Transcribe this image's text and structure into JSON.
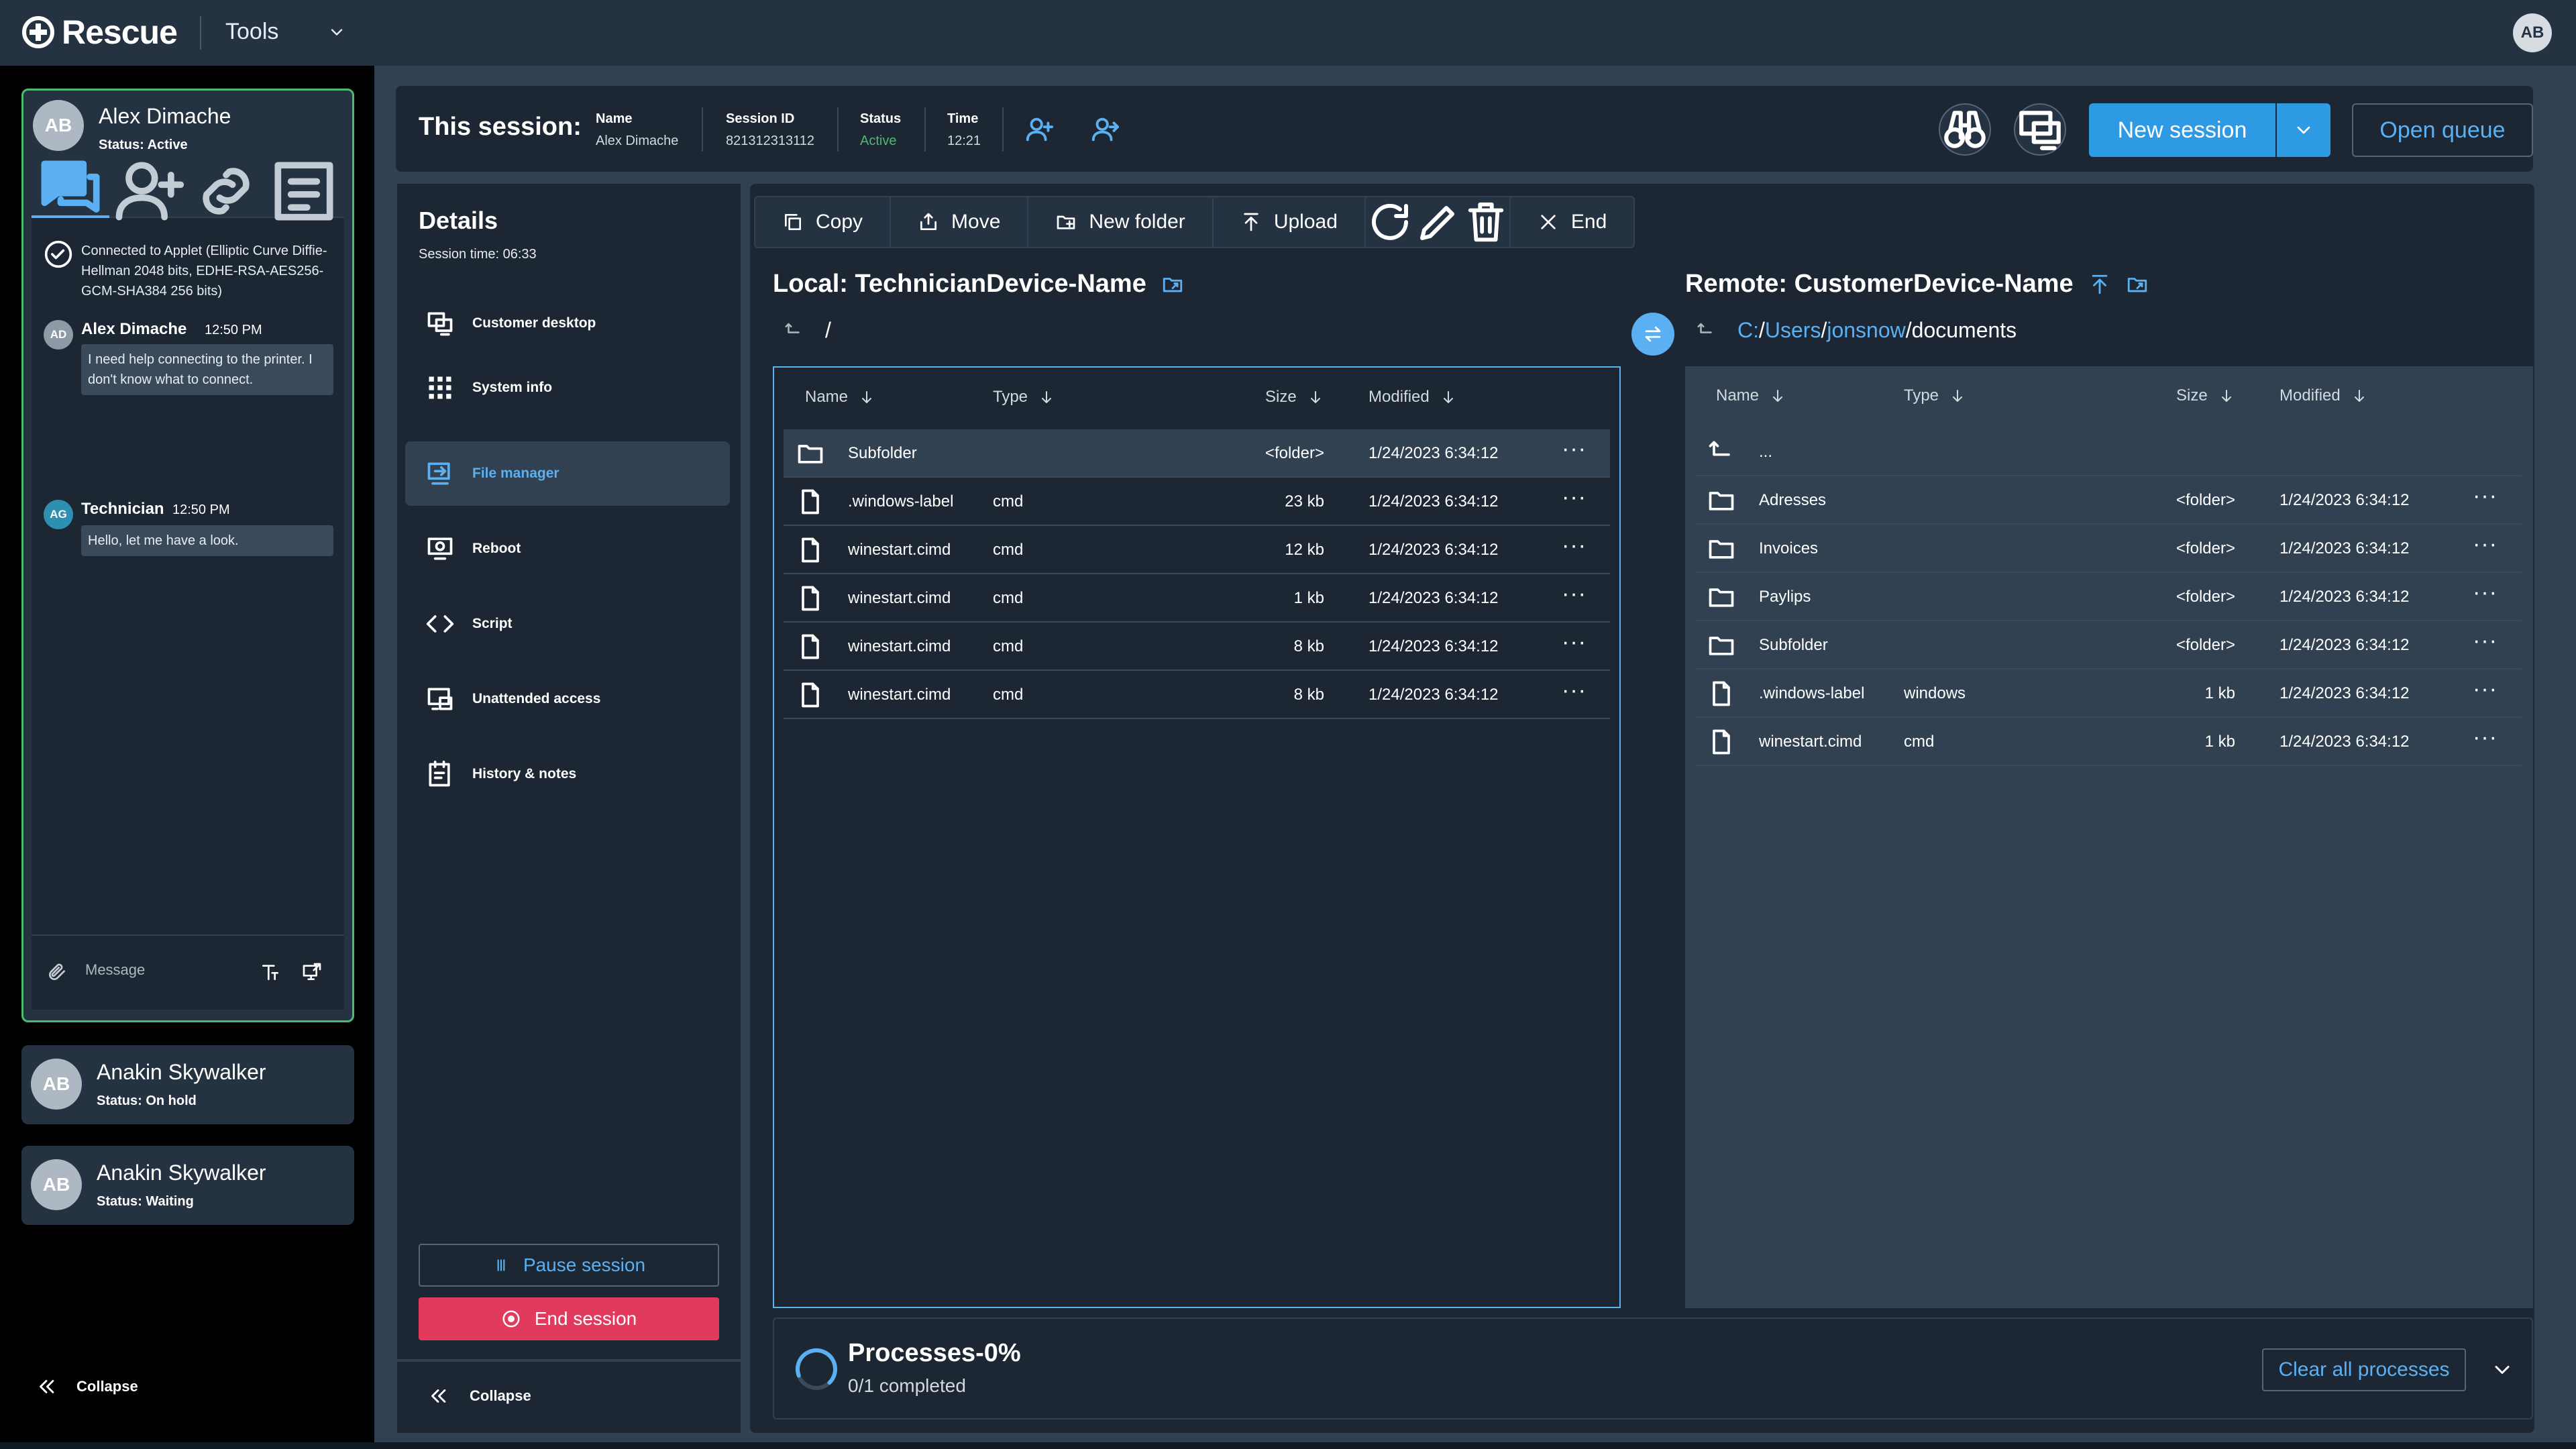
{
  "topbar": {
    "brand": "Rescue",
    "menu_label": "Tools",
    "user_initials": "AB"
  },
  "sessions": [
    {
      "initials": "AB",
      "name": "Alex Dimache",
      "status": "Status: Active"
    },
    {
      "initials": "AB",
      "name": "Anakin Skywalker",
      "status": "Status: On hold"
    },
    {
      "initials": "AB",
      "name": "Anakin Skywalker",
      "status": "Status: Waiting"
    }
  ],
  "chat": {
    "tabs": [
      "chat-icon",
      "add-user-icon",
      "link-icon",
      "notes-icon"
    ],
    "system_message": "Connected to Applet (Elliptic Curve Diffie-Hellman 2048 bits, EDHE-RSA-AES256-GCM-SHA384 256 bits)",
    "messages": [
      {
        "initials": "AD",
        "sender": "Alex Dimache",
        "time": "12:50 PM",
        "text": "I need help connecting to the printer. I don't know what to connect."
      },
      {
        "initials": "AG",
        "sender": "Technician",
        "time": "12:50 PM",
        "text": "Hello, let me have a look."
      }
    ],
    "input_placeholder": "Message"
  },
  "sidebar_collapse": "Collapse",
  "session_bar": {
    "title": "This session:",
    "fields": [
      {
        "label": "Name",
        "value": "Alex Dimache"
      },
      {
        "label": "Session ID",
        "value": "821312313112"
      },
      {
        "label": "Status",
        "value": "Active"
      },
      {
        "label": "Time",
        "value": "12:21"
      }
    ],
    "new_session": "New session",
    "open_queue": "Open queue"
  },
  "details": {
    "title": "Details",
    "session_time": "Session time: 06:33",
    "menu": [
      "Customer desktop",
      "System info",
      "File manager",
      "Reboot",
      "Script",
      "Unattended access",
      "History & notes"
    ],
    "pause": "Pause session",
    "end": "End session",
    "collapse": "Collapse"
  },
  "toolbar": {
    "copy": "Copy",
    "move": "Move",
    "new_folder": "New folder",
    "upload": "Upload",
    "end": "End"
  },
  "local": {
    "title": "Local: TechnicianDevice-Name",
    "path": "/",
    "headers": [
      "Name",
      "Type",
      "Size",
      "Modified"
    ],
    "rows": [
      {
        "icon": "folder-icon",
        "name": "Subfolder",
        "type": "",
        "size": "<folder>",
        "modified": "1/24/2023 6:34:12"
      },
      {
        "icon": "file-icon",
        "name": ".windows-label",
        "type": "cmd",
        "size": "23 kb",
        "modified": "1/24/2023 6:34:12"
      },
      {
        "icon": "file-icon",
        "name": "winestart.cimd",
        "type": "cmd",
        "size": "12 kb",
        "modified": "1/24/2023 6:34:12"
      },
      {
        "icon": "file-icon",
        "name": "winestart.cimd",
        "type": "cmd",
        "size": "1 kb",
        "modified": "1/24/2023 6:34:12"
      },
      {
        "icon": "file-icon",
        "name": "winestart.cimd",
        "type": "cmd",
        "size": "8 kb",
        "modified": "1/24/2023 6:34:12"
      },
      {
        "icon": "file-icon",
        "name": "winestart.cimd",
        "type": "cmd",
        "size": "8 kb",
        "modified": "1/24/2023 6:34:12"
      }
    ]
  },
  "remote": {
    "title": "Remote: CustomerDevice-Name",
    "path": {
      "drive": "C:",
      "sep1": "/",
      "users": "Users",
      "sep2": "/",
      "user": "jonsnow",
      "rest": "/documents"
    },
    "headers": [
      "Name",
      "Type",
      "Size",
      "Modified"
    ],
    "up_label": "...",
    "rows": [
      {
        "icon": "folder-icon",
        "name": "Adresses",
        "type": "",
        "size": "<folder>",
        "modified": "1/24/2023 6:34:12"
      },
      {
        "icon": "folder-icon",
        "name": "Invoices",
        "type": "",
        "size": "<folder>",
        "modified": "1/24/2023 6:34:12"
      },
      {
        "icon": "folder-icon",
        "name": "Paylips",
        "type": "",
        "size": "<folder>",
        "modified": "1/24/2023 6:34:12"
      },
      {
        "icon": "folder-icon",
        "name": "Subfolder",
        "type": "",
        "size": "<folder>",
        "modified": "1/24/2023 6:34:12"
      },
      {
        "icon": "file-icon",
        "name": ".windows-label",
        "type": "windows",
        "size": "1 kb",
        "modified": "1/24/2023 6:34:12"
      },
      {
        "icon": "file-icon",
        "name": "winestart.cimd",
        "type": "cmd",
        "size": "1 kb",
        "modified": "1/24/2023 6:34:12"
      }
    ]
  },
  "processes": {
    "title": "Processes-0%",
    "subtitle": "0/1 completed",
    "progress": 0,
    "clear": "Clear all processes"
  },
  "colors": {
    "accent": "#5ab0f2",
    "primary_button": "#2f9ae4",
    "danger": "#e23a5c",
    "active_status": "#4cba6f"
  }
}
